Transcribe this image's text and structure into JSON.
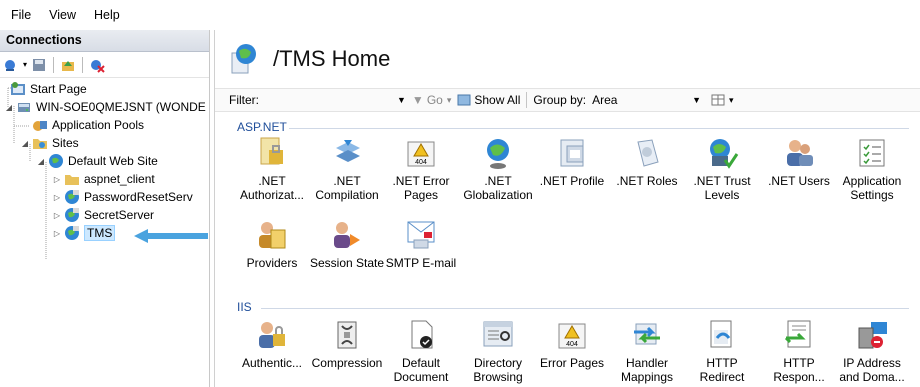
{
  "menu": {
    "items": [
      "File",
      "View",
      "Help"
    ]
  },
  "connections": {
    "title": "Connections",
    "tree": [
      {
        "label": "Start Page"
      },
      {
        "label": "WIN-SOE0QMEJSNT (WONDE"
      },
      {
        "label": "Application Pools"
      },
      {
        "label": "Sites"
      },
      {
        "label": "Default Web Site"
      },
      {
        "label": "aspnet_client"
      },
      {
        "label": "PasswordResetServ"
      },
      {
        "label": "SecretServer"
      },
      {
        "label": "TMS"
      }
    ]
  },
  "main": {
    "title": "/TMS Home",
    "filter": {
      "label": "Filter:",
      "value": "",
      "go": "Go",
      "show_all": "Show All",
      "group_by_label": "Group by:",
      "group_by_value": "Area"
    },
    "groups": [
      {
        "name": "ASP.NET",
        "features": [
          {
            "label": ".NET Authorizat...",
            "icon": "authorization-rules-icon"
          },
          {
            "label": ".NET Compilation",
            "icon": "compilation-icon"
          },
          {
            "label": ".NET Error Pages",
            "icon": "error-pages-icon"
          },
          {
            "label": ".NET Globalization",
            "icon": "globalization-icon"
          },
          {
            "label": ".NET Profile",
            "icon": "profile-icon"
          },
          {
            "label": ".NET Roles",
            "icon": "roles-icon"
          },
          {
            "label": ".NET Trust Levels",
            "icon": "trust-levels-icon"
          },
          {
            "label": ".NET Users",
            "icon": "users-icon"
          },
          {
            "label": "Application Settings",
            "icon": "app-settings-icon"
          },
          {
            "label": "Providers",
            "icon": "providers-icon"
          },
          {
            "label": "Session State",
            "icon": "session-state-icon"
          },
          {
            "label": "SMTP E-mail",
            "icon": "smtp-email-icon"
          }
        ]
      },
      {
        "name": "IIS",
        "features": [
          {
            "label": "Authentic...",
            "icon": "authentication-icon"
          },
          {
            "label": "Compression",
            "icon": "compression-icon"
          },
          {
            "label": "Default Document",
            "icon": "default-document-icon"
          },
          {
            "label": "Directory Browsing",
            "icon": "directory-browsing-icon"
          },
          {
            "label": "Error Pages",
            "icon": "error-pages-icon"
          },
          {
            "label": "Handler Mappings",
            "icon": "handler-mappings-icon"
          },
          {
            "label": "HTTP Redirect",
            "icon": "http-redirect-icon"
          },
          {
            "label": "HTTP Respon...",
            "icon": "http-response-headers-icon"
          },
          {
            "label": "IP Address and Doma...",
            "icon": "ip-address-icon"
          }
        ]
      }
    ]
  },
  "colors": {
    "accent": "#1f4e9a",
    "arrow": "#4aa3df",
    "selection": "#cce8ff"
  }
}
